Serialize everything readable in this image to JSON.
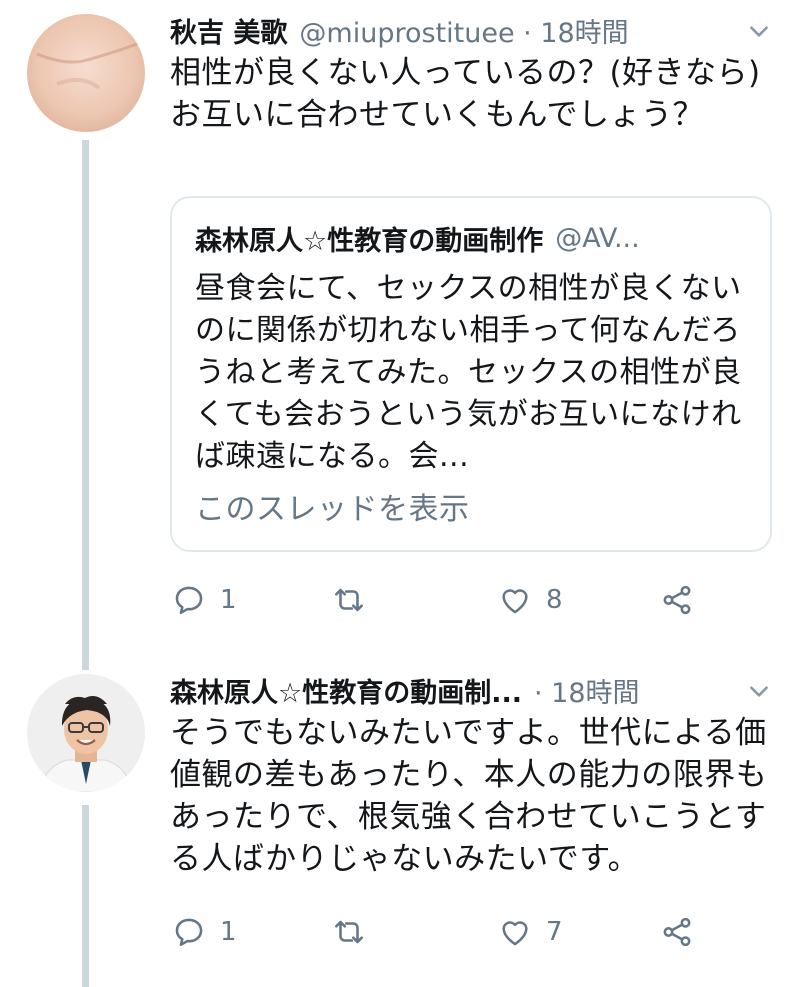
{
  "tweets": [
    {
      "author_name": "秋吉 美歌",
      "meta": "@miuprostituee · 18時間",
      "text": "相性が良くない人っているの？(好きなら)お互いに合わせていくもんでしょう？",
      "quote": {
        "author_name": "森林原人☆性教育の動画制作",
        "handle": "@AV...",
        "text": "昼食会にて、セックスの相性が良くないのに関係が切れない相手って何なんだろうねと考えてみた。セックスの相性が良くても会おうという気がお互いになければ疎遠になる。会...",
        "show_thread": "このスレッドを表示"
      },
      "actions": {
        "reply_count": "1",
        "retweet_count": "",
        "like_count": "8"
      }
    },
    {
      "author_name": "森林原人☆性教育の動画制...",
      "meta": "· 18時間",
      "text": "そうでもないみたいですよ。世代による価値観の差もあったり、本人の能力の限界もあったりで、根気強く合わせていこうとする人ばかりじゃないみたいです。",
      "actions": {
        "reply_count": "1",
        "retweet_count": "",
        "like_count": "7"
      }
    }
  ],
  "colors": {
    "text": "#14171a",
    "secondary": "#657786",
    "thread_line": "#ccd6dd",
    "border": "#e1e8ed"
  }
}
